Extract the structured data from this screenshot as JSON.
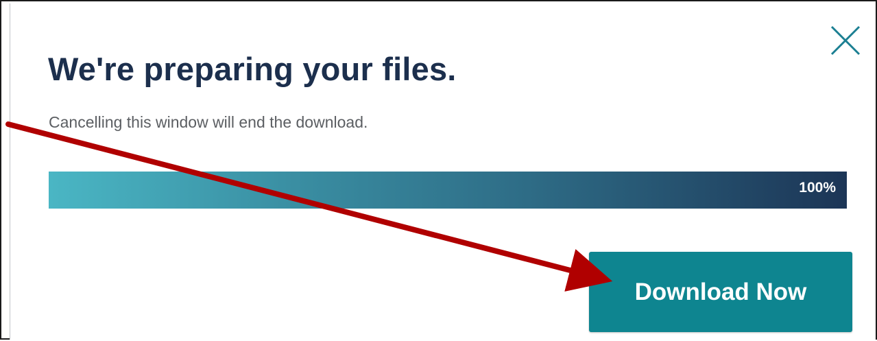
{
  "dialog": {
    "title": "We're preparing your files.",
    "subtitle": "Cancelling this window will end the download.",
    "progress": {
      "percent": 100,
      "label": "100%"
    },
    "download_button_label": "Download Now",
    "close_icon": "close-icon"
  },
  "annotation": {
    "arrow_color": "#b00000",
    "icon": "arrow-annotation"
  },
  "colors": {
    "title": "#1c2f4d",
    "subtitle": "#5b5e62",
    "button": "#0e8590",
    "progress_start": "#4ab6c4",
    "progress_end": "#1c3556"
  }
}
